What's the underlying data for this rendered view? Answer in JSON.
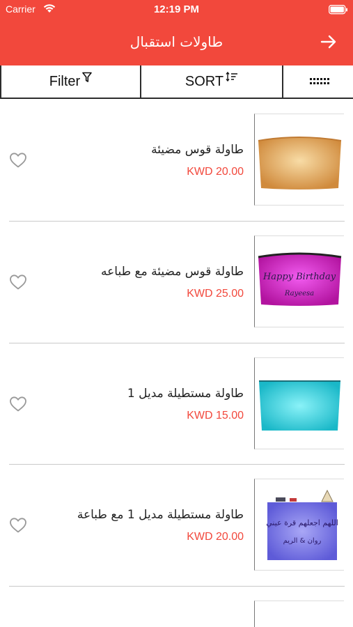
{
  "status_bar": {
    "carrier": "Carrier",
    "time": "12:19 PM"
  },
  "header": {
    "title": "طاولات استقبال"
  },
  "toolbar": {
    "filter_label": "Filter",
    "sort_label": "SORT"
  },
  "products": [
    {
      "name": "طاولة قوس مضيئة",
      "price": "KWD 20.00",
      "color": "#e9a95a"
    },
    {
      "name": "طاولة قوس مضيئة مع طباعه",
      "price": "KWD 25.00",
      "color": "#d21ec9",
      "print_text": "Happy Birthday",
      "print_name": "Rayeesa"
    },
    {
      "name": "طاولة مستطيلة مديل 1",
      "price": "KWD 15.00",
      "color": "#30d4e2"
    },
    {
      "name": "طاولة مستطيلة مديل 1 مع طباعة",
      "price": "KWD 20.00",
      "color": "#7c79e6",
      "print_text": "اللهم اجعلهم قرة عيني",
      "print_name": "روان & الريم"
    }
  ],
  "colors": {
    "accent": "#f2483c"
  }
}
